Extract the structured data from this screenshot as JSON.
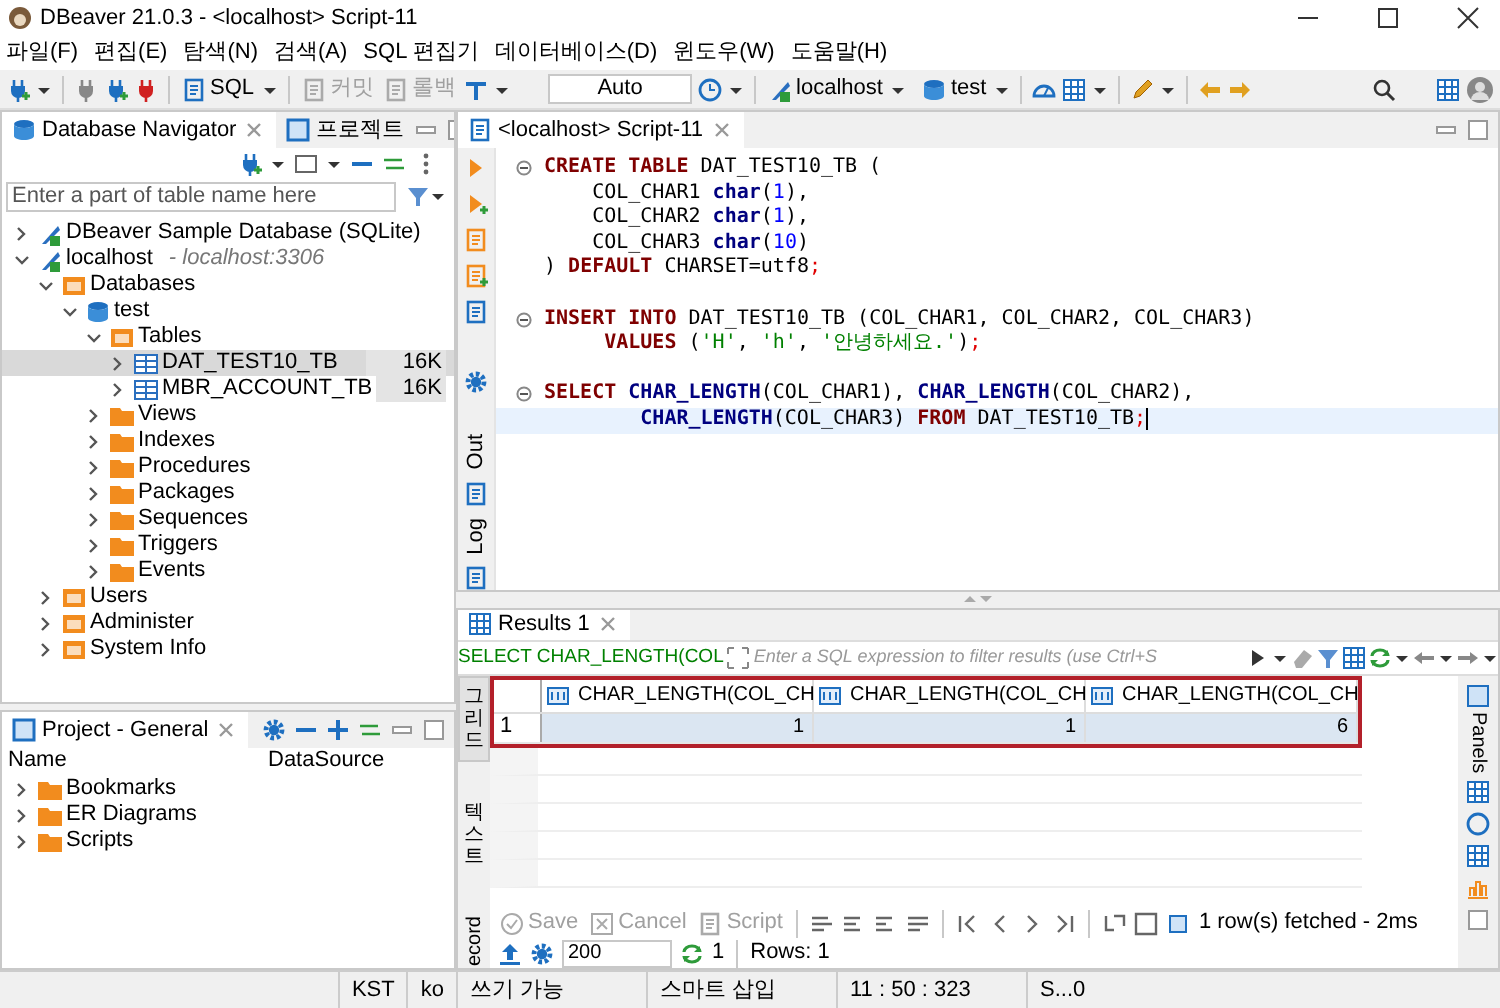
{
  "window": {
    "title": "DBeaver 21.0.3 - <localhost> Script-11"
  },
  "menu": [
    "파일(F)",
    "편집(E)",
    "탐색(N)",
    "검색(A)",
    "SQL 편집기",
    "데이터베이스(D)",
    "윈도우(W)",
    "도움말(H)"
  ],
  "toolbar": {
    "sql": "SQL",
    "commit": {
      "label": "커밋",
      "disabled": true
    },
    "rollback": {
      "label": "롤백",
      "disabled": true
    },
    "mode": "Auto",
    "connection": "localhost",
    "database": "test"
  },
  "navigator": {
    "tabs": [
      {
        "label": "Database Navigator",
        "selected": true
      },
      {
        "label": "프로젝트",
        "selected": false
      }
    ],
    "search": {
      "placeholder": "Enter a part of table name here"
    },
    "tree": [
      {
        "label": "DBeaver Sample Database (SQLite)",
        "kind": "connection",
        "expanded": false,
        "selected": false
      },
      {
        "label": "localhost",
        "detail": "- localhost:3306",
        "kind": "connection",
        "expanded": true,
        "selected": false,
        "children": [
          {
            "label": "Databases",
            "kind": "group",
            "expanded": true,
            "selected": false,
            "children": [
              {
                "label": "test",
                "kind": "database",
                "expanded": true,
                "selected": false,
                "children": [
                  {
                    "label": "Tables",
                    "kind": "group",
                    "expanded": true,
                    "selected": false,
                    "children": [
                      {
                        "label": "DAT_TEST10_TB",
                        "kind": "table",
                        "size": "16K",
                        "expanded": false,
                        "selected": true
                      },
                      {
                        "label": "MBR_ACCOUNT_TB",
                        "kind": "table",
                        "size": "16K",
                        "expanded": false,
                        "selected": false
                      }
                    ]
                  },
                  {
                    "label": "Views",
                    "kind": "folder",
                    "expanded": false,
                    "selected": false
                  },
                  {
                    "label": "Indexes",
                    "kind": "folder",
                    "expanded": false,
                    "selected": false
                  },
                  {
                    "label": "Procedures",
                    "kind": "folder",
                    "expanded": false,
                    "selected": false
                  },
                  {
                    "label": "Packages",
                    "kind": "folder",
                    "expanded": false,
                    "selected": false
                  },
                  {
                    "label": "Sequences",
                    "kind": "folder",
                    "expanded": false,
                    "selected": false
                  },
                  {
                    "label": "Triggers",
                    "kind": "folder",
                    "expanded": false,
                    "selected": false
                  },
                  {
                    "label": "Events",
                    "kind": "folder",
                    "expanded": false,
                    "selected": false
                  }
                ]
              }
            ]
          },
          {
            "label": "Users",
            "kind": "group",
            "expanded": false,
            "selected": false
          },
          {
            "label": "Administer",
            "kind": "group",
            "expanded": false,
            "selected": false
          },
          {
            "label": "System Info",
            "kind": "group",
            "expanded": false,
            "selected": false
          }
        ]
      }
    ]
  },
  "project": {
    "title": "Project - General",
    "columns": [
      "Name",
      "DataSource"
    ],
    "items": [
      {
        "label": "Bookmarks",
        "expanded": false
      },
      {
        "label": "ER Diagrams",
        "expanded": false
      },
      {
        "label": "Scripts",
        "expanded": false
      }
    ]
  },
  "editor": {
    "tab": {
      "label": "<localhost> Script-11",
      "selected": true
    },
    "side_labels": [
      "Out",
      "Log"
    ],
    "lines": [
      {
        "kind": "code",
        "fold": true,
        "current": false,
        "tokens": [
          {
            "kind": "keyword",
            "text": "CREATE TABLE"
          },
          {
            "kind": "plain",
            "text": " DAT_TEST10_TB ("
          }
        ]
      },
      {
        "kind": "code",
        "fold": false,
        "current": false,
        "tokens": [
          {
            "kind": "plain",
            "text": "    COL_CHAR1 "
          },
          {
            "kind": "type",
            "text": "char"
          },
          {
            "kind": "plain",
            "text": "("
          },
          {
            "kind": "number",
            "text": "1"
          },
          {
            "kind": "plain",
            "text": "),"
          }
        ]
      },
      {
        "kind": "code",
        "fold": false,
        "current": false,
        "tokens": [
          {
            "kind": "plain",
            "text": "    COL_CHAR2 "
          },
          {
            "kind": "type",
            "text": "char"
          },
          {
            "kind": "plain",
            "text": "("
          },
          {
            "kind": "number",
            "text": "1"
          },
          {
            "kind": "plain",
            "text": "),"
          }
        ]
      },
      {
        "kind": "code",
        "fold": false,
        "current": false,
        "tokens": [
          {
            "kind": "plain",
            "text": "    COL_CHAR3 "
          },
          {
            "kind": "type",
            "text": "char"
          },
          {
            "kind": "plain",
            "text": "("
          },
          {
            "kind": "number",
            "text": "10"
          },
          {
            "kind": "plain",
            "text": ")"
          }
        ]
      },
      {
        "kind": "code",
        "fold": false,
        "current": false,
        "tokens": [
          {
            "kind": "plain",
            "text": ") "
          },
          {
            "kind": "keyword",
            "text": "DEFAULT"
          },
          {
            "kind": "plain",
            "text": " CHARSET=utf8"
          },
          {
            "kind": "punct",
            "text": ";"
          }
        ]
      },
      {
        "kind": "blank"
      },
      {
        "kind": "code",
        "fold": true,
        "current": false,
        "tokens": [
          {
            "kind": "keyword",
            "text": "INSERT INTO"
          },
          {
            "kind": "plain",
            "text": " DAT_TEST10_TB (COL_CHAR1, COL_CHAR2, COL_CHAR3)"
          }
        ]
      },
      {
        "kind": "code",
        "fold": false,
        "current": false,
        "tokens": [
          {
            "kind": "keyword",
            "text": "     VALUES"
          },
          {
            "kind": "plain",
            "text": " ("
          },
          {
            "kind": "string",
            "text": "'H'"
          },
          {
            "kind": "plain",
            "text": ", "
          },
          {
            "kind": "string",
            "text": "'h'"
          },
          {
            "kind": "plain",
            "text": ", "
          },
          {
            "kind": "string",
            "text": "'안녕하세요.'"
          },
          {
            "kind": "plain",
            "text": ")"
          },
          {
            "kind": "punct",
            "text": ";"
          }
        ]
      },
      {
        "kind": "blank"
      },
      {
        "kind": "code",
        "fold": true,
        "current": false,
        "tokens": [
          {
            "kind": "keyword",
            "text": "SELECT "
          },
          {
            "kind": "function",
            "text": "CHAR_LENGTH"
          },
          {
            "kind": "plain",
            "text": "(COL_CHAR1), "
          },
          {
            "kind": "function",
            "text": "CHAR_LENGTH"
          },
          {
            "kind": "plain",
            "text": "(COL_CHAR2),"
          }
        ]
      },
      {
        "kind": "code",
        "fold": false,
        "current": true,
        "tokens": [
          {
            "kind": "function",
            "text": "        CHAR_LENGTH"
          },
          {
            "kind": "plain",
            "text": "(COL_CHAR3) "
          },
          {
            "kind": "keyword",
            "text": "FROM"
          },
          {
            "kind": "plain",
            "text": " DAT_TEST10_TB"
          },
          {
            "kind": "punct",
            "text": ";"
          }
        ]
      }
    ]
  },
  "results": {
    "tab": {
      "label": "Results 1",
      "selected": true
    },
    "query": "SELECT CHAR_LENGTH(COL",
    "filter": {
      "placeholder": "Enter a SQL expression to filter results (use Ctrl+S"
    },
    "view_tabs": [
      {
        "label": "그리드",
        "kind": "vertical-korean",
        "selected": true
      },
      {
        "label": "텍스트",
        "kind": "vertical-korean",
        "selected": false
      },
      {
        "label": "ecord",
        "kind": "rotated",
        "selected": false
      }
    ],
    "grid": {
      "highlighted": true,
      "columns": [
        "CHAR_LENGTH(COL_CH",
        "CHAR_LENGTH(COL_CH",
        "CHAR_LENGTH(COL_CH"
      ],
      "rows": [
        {
          "number": "1",
          "selected": true,
          "cells": [
            "1",
            "1",
            "6"
          ]
        }
      ]
    },
    "actions": [
      {
        "label": "Save",
        "disabled": true
      },
      {
        "label": "Cancel",
        "disabled": true
      },
      {
        "label": "Script",
        "disabled": true
      }
    ],
    "fetch_status": "1 row(s) fetched - 2ms",
    "fetch_size": "200",
    "refresh_count": "1",
    "rows_count": "Rows: 1",
    "panels_label": "Panels"
  },
  "status_bar": {
    "left": [
      "KST",
      "ko"
    ],
    "right": [
      "쓰기 가능",
      "스마트 삽입",
      "11 : 50 : 323",
      "S...0"
    ]
  }
}
